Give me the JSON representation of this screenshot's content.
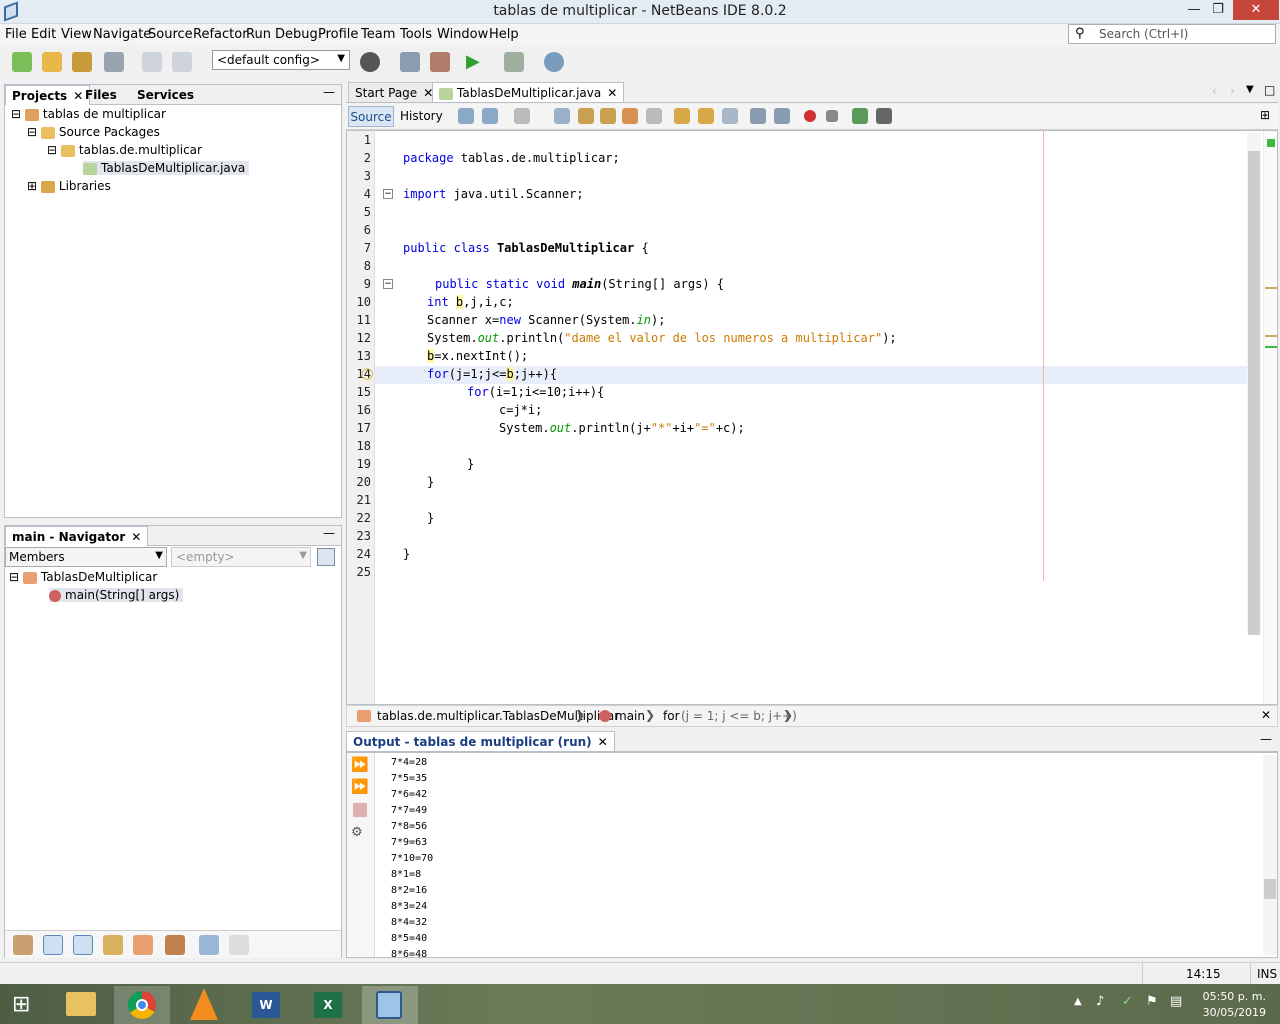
{
  "window": {
    "title": "tablas de multiplicar - NetBeans IDE 8.0.2"
  },
  "menu": [
    "File",
    "Edit",
    "View",
    "Navigate",
    "Source",
    "Refactor",
    "Run",
    "Debug",
    "Profile",
    "Team",
    "Tools",
    "Window",
    "Help"
  ],
  "search": {
    "placeholder": "Search (Ctrl+I)"
  },
  "toolbar": {
    "config": "<default config>"
  },
  "projects_panel": {
    "tabs": [
      "Projects",
      "Files",
      "Services"
    ],
    "tree": [
      "tablas de multiplicar",
      "Source Packages",
      "tablas.de.multiplicar",
      "TablasDeMultiplicar.java",
      "Libraries"
    ]
  },
  "navigator": {
    "title": "main - Navigator",
    "filter": "Members",
    "empty": "<empty>",
    "tree": [
      "TablasDeMultiplicar",
      "main(String[] args)"
    ]
  },
  "editor_tabs": [
    "Start Page",
    "TablasDeMultiplicar.java"
  ],
  "editor_subtabs": [
    "Source",
    "History"
  ],
  "code_lines": [
    "1",
    "2",
    "3",
    "4",
    "5",
    "6",
    "7",
    "8",
    "9",
    "10",
    "11",
    "12",
    "13",
    "14",
    "15",
    "16",
    "17",
    "18",
    "19",
    "20",
    "21",
    "22",
    "23",
    "24",
    "25"
  ],
  "breadcrumb": [
    "tablas.de.multiplicar.TablasDeMultiplicar",
    "main",
    "for",
    "(j = 1; j <= b; j++)"
  ],
  "output": {
    "title": "Output - tablas de multiplicar (run)",
    "lines": [
      "7*4=28",
      "7*5=35",
      "7*6=42",
      "7*7=49",
      "7*8=56",
      "7*9=63",
      "7*10=70",
      "8*1=8",
      "8*2=16",
      "8*3=24",
      "8*4=32",
      "8*5=40",
      "8*6=48"
    ]
  },
  "status": {
    "position": "14:15",
    "mode": "INS"
  },
  "clock": {
    "time": "05:50 p. m.",
    "date": "30/05/2019"
  }
}
